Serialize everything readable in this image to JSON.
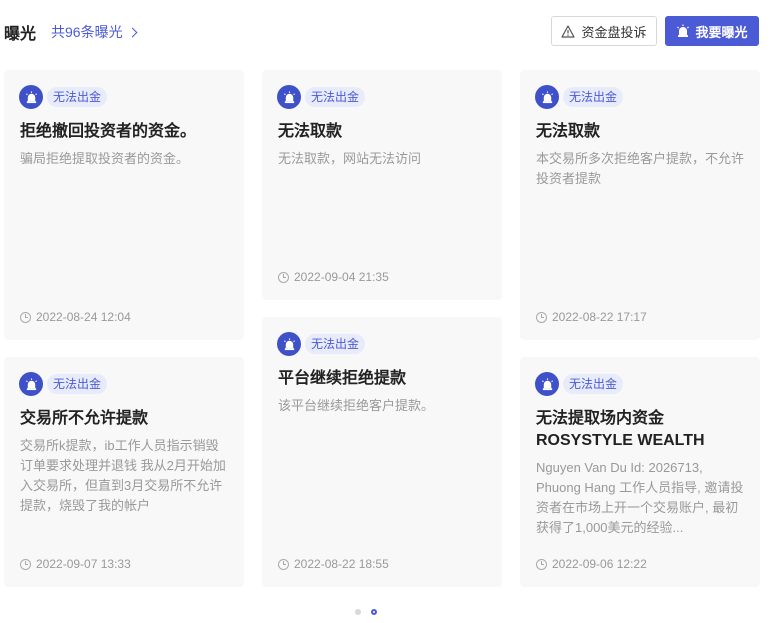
{
  "header": {
    "title": "曝光",
    "count_link": "共96条曝光",
    "complain_button": "资金盘投诉",
    "expose_button": "我要曝光"
  },
  "cards": [
    {
      "tag": "无法出金",
      "title": "拒绝撤回投资者的资金。",
      "desc": "骗局拒绝提取投资者的资金。",
      "time": "2022-08-24 12:04"
    },
    {
      "tag": "无法出金",
      "title": "无法取款",
      "desc": "无法取款，网站无法访问",
      "time": "2022-09-04 21:35"
    },
    {
      "tag": "无法出金",
      "title": "无法取款",
      "desc": "本交易所多次拒绝客户提款，不允许投资者提款",
      "time": "2022-08-22 17:17"
    },
    {
      "tag": "无法出金",
      "title": "交易所不允许提款",
      "desc": "交易所k提款，ib工作人员指示销毁订单要求处理并退钱 我从2月开始加入交易所，但直到3月交易所不允许提款，烧毁了我的帐户",
      "time": "2022-09-07 13:33"
    },
    {
      "tag": "无法出金",
      "title": "平台继续拒绝提款",
      "desc": "该平台继续拒绝客户提款。",
      "time": "2022-08-22 18:55"
    },
    {
      "tag": "无法出金",
      "title": "无法提取场内资金 ROSYSTYLE WEALTH",
      "desc": "Nguyen Van Du Id: 2026713, Phuong Hang 工作人员指导, 邀请投资者在市场上开一个交易账户, 最初获得了1,000美元的经验...",
      "time": "2022-09-06 12:22"
    }
  ],
  "pagination": {
    "total": 2,
    "active": 2
  }
}
